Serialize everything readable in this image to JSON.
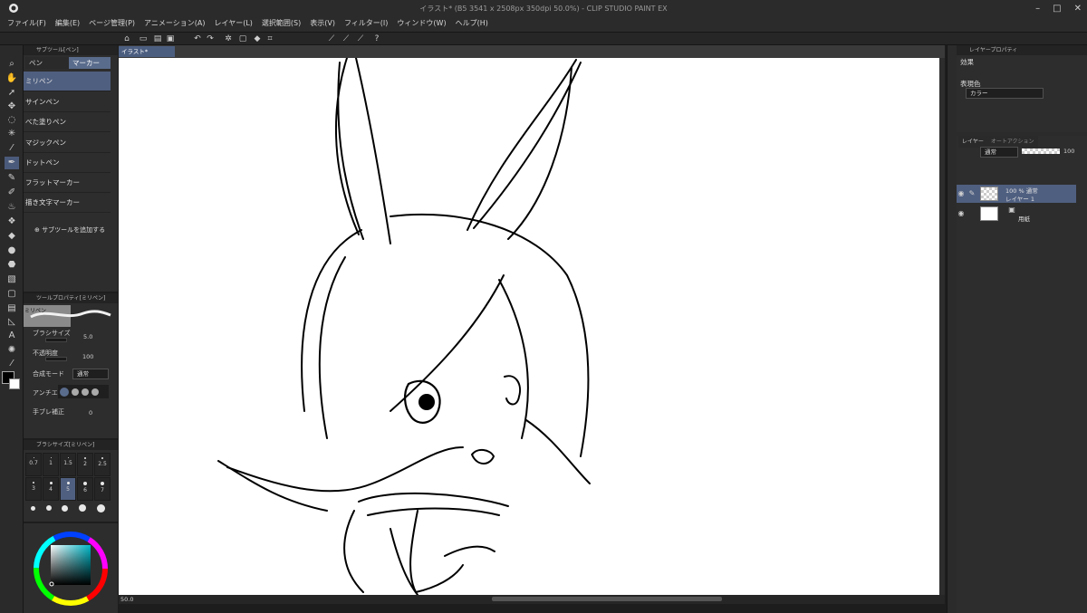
{
  "window": {
    "title": "イラスト* (B5 3541 x 2508px 350dpi 50.0%) - CLIP STUDIO PAINT EX",
    "controls": [
      "–",
      "□",
      "✕"
    ]
  },
  "menu": [
    "ファイル(F)",
    "編集(E)",
    "ページ管理(P)",
    "アニメーション(A)",
    "レイヤー(L)",
    "選択範囲(S)",
    "表示(V)",
    "フィルター(I)",
    "ウィンドウ(W)",
    "ヘルプ(H)"
  ],
  "document_tab": "イラスト*",
  "subtool_panel": {
    "header": "サブツール[ペン]",
    "tabs": [
      "ペン",
      "マーカー"
    ],
    "items": [
      "ミリペン",
      "サインペン",
      "べた塗りペン",
      "マジックペン",
      "ドットペン",
      "フラットマーカー",
      "描き文字マーカー"
    ],
    "add_label": "サブツールを追加する"
  },
  "tool_property": {
    "header": "ツールプロパティ[ミリペン]",
    "tool_name": "ミリペン",
    "brush_size_label": "ブラシサイズ",
    "brush_size_value": "5.0",
    "opacity_label": "不透明度",
    "opacity_value": "100",
    "blend_label": "合成モード",
    "blend_value": "通常",
    "antialias_label": "アンチエイリ",
    "stabilization_label": "手ブレ補正",
    "stabilization_value": "0"
  },
  "brush_size_panel": {
    "header": "ブラシサイズ[ミリペン]",
    "row1": [
      "0.7",
      "1",
      "1.5",
      "2",
      "2.5"
    ],
    "row2": [
      "3",
      "4",
      "5",
      "6",
      "7"
    ],
    "selected": "5"
  },
  "status": {
    "zoom": "50.0"
  },
  "layer_property": {
    "header": "レイヤープロパティ",
    "effect_label": "効果",
    "color_label": "表現色",
    "color_value": "カラー"
  },
  "layer_panel": {
    "tabs": [
      "レイヤー",
      "オートアクション"
    ],
    "blend": "通常",
    "opacity": "100",
    "layers": [
      {
        "line1": "100 % 通常",
        "line2": "レイヤー 1"
      },
      {
        "line1": "",
        "line2": "用紙"
      }
    ]
  },
  "colors": {
    "accent": "#4f5f80",
    "panel": "#2d2d2d",
    "canvas": "#ffffff"
  }
}
